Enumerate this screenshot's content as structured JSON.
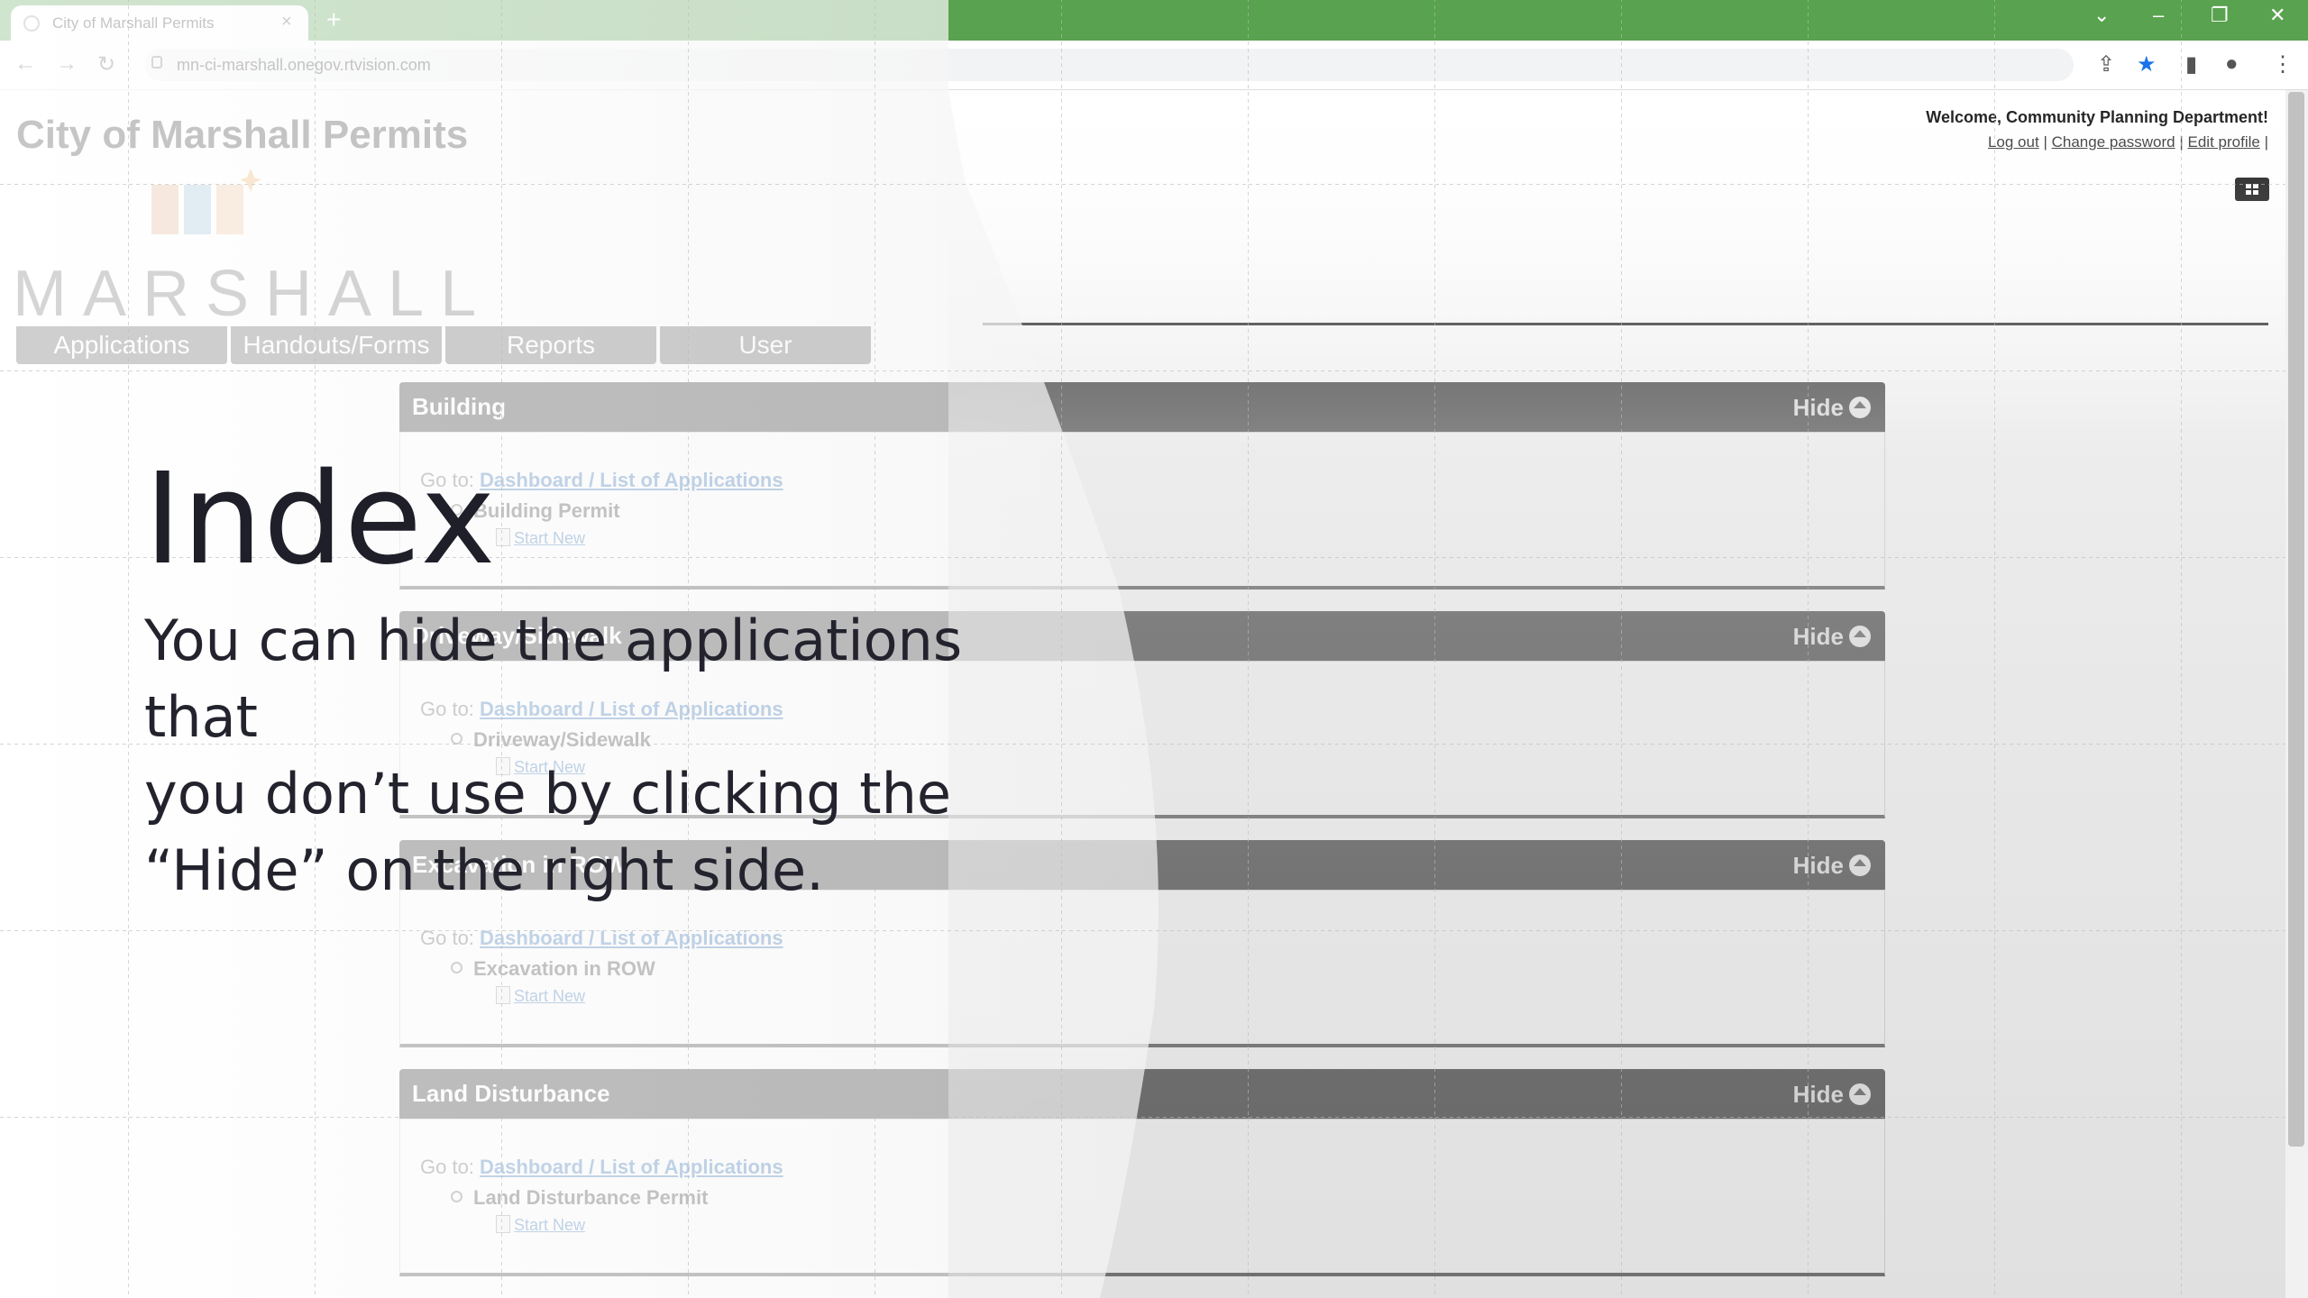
{
  "browser": {
    "tab_title": "City of Marshall Permits",
    "url": "mn-ci-marshall.onegov.rtvision.com",
    "new_tab": "+",
    "tab_close": "×"
  },
  "colors": {
    "titlebar": "#59a24f",
    "section_header": "#1d1d1d",
    "link": "#2a6bb3"
  },
  "site": {
    "title": "City of Marshall Permits",
    "logo_text": "MARSHALL"
  },
  "account": {
    "welcome": "Welcome, Community Planning Department!",
    "logout": "Log out",
    "change_password": "Change password",
    "edit_profile": "Edit profile",
    "sep": "|"
  },
  "nav": {
    "items": [
      "Applications",
      "Handouts/Forms",
      "Reports",
      "User"
    ]
  },
  "sections": [
    {
      "title": "Building",
      "hide": "Hide",
      "goto_prefix": "Go to:",
      "goto_link": "Dashboard / List of Applications",
      "permit": "Building Permit",
      "start_new": "Start New"
    },
    {
      "title": "Driveway/Sidewalk",
      "hide": "Hide",
      "goto_prefix": "Go to:",
      "goto_link": "Dashboard / List of Applications",
      "permit": "Driveway/Sidewalk",
      "start_new": "Start New"
    },
    {
      "title": "Excavation in ROW",
      "hide": "Hide",
      "goto_prefix": "Go to:",
      "goto_link": "Dashboard / List of Applications",
      "permit": "Excavation in ROW",
      "start_new": "Start New"
    },
    {
      "title": "Land Disturbance",
      "hide": "Hide",
      "goto_prefix": "Go to:",
      "goto_link": "Dashboard / List of Applications",
      "permit": "Land Disturbance Permit",
      "start_new": "Start New"
    }
  ],
  "overlay": {
    "heading": "Index",
    "line1": "You can hide the applications that",
    "line2": "you don’t use by clicking the",
    "line3": "“Hide” on the right side."
  }
}
